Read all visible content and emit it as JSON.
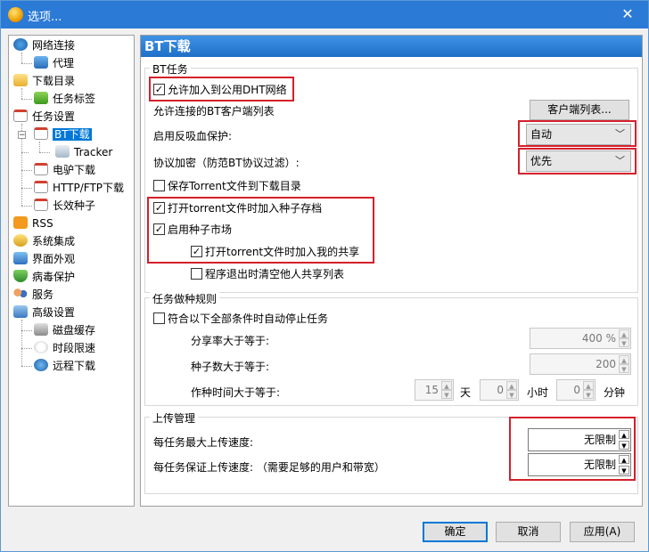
{
  "window": {
    "title": "选项..."
  },
  "tree": {
    "items": [
      {
        "label": "网络连接"
      },
      {
        "label": "代理"
      },
      {
        "label": "下载目录"
      },
      {
        "label": "任务标签"
      },
      {
        "label": "任务设置"
      },
      {
        "label": "BT下载"
      },
      {
        "label": "Tracker"
      },
      {
        "label": "电驴下载"
      },
      {
        "label": "HTTP/FTP下载"
      },
      {
        "label": "长效种子"
      },
      {
        "label": "RSS"
      },
      {
        "label": "系统集成"
      },
      {
        "label": "界面外观"
      },
      {
        "label": "病毒保护"
      },
      {
        "label": "服务"
      },
      {
        "label": "高级设置"
      },
      {
        "label": "磁盘缓存"
      },
      {
        "label": "时段限速"
      },
      {
        "label": "远程下载"
      }
    ]
  },
  "panel": {
    "title": "BT下载",
    "bt_task": {
      "group_title": "BT任务",
      "allow_dht": {
        "label": "允许加入到公用DHT网络",
        "checked": true
      },
      "allowed_clients_label": "允许连接的BT客户端列表",
      "client_list_button": "客户端列表...",
      "anti_leech_label": "启用反吸血保护:",
      "anti_leech_value": "自动",
      "protocol_encryption_label": "协议加密（防范BT协议过滤）:",
      "protocol_encryption_value": "优先",
      "save_torrent": {
        "label": "保存Torrent文件到下载目录",
        "checked": false
      },
      "add_to_seed_archive": {
        "label": "打开torrent文件时加入种子存档",
        "checked": true
      },
      "enable_seed_market": {
        "label": "启用种子市场",
        "checked": true
      },
      "add_to_my_share": {
        "label": "打开torrent文件时加入我的共享",
        "checked": true
      },
      "clear_others_share": {
        "label": "程序退出时清空他人共享列表",
        "checked": false
      }
    },
    "seeding_rules": {
      "group_title": "任务做种规则",
      "auto_stop": {
        "label": "符合以下全部条件时自动停止任务",
        "checked": false
      },
      "share_ratio_label": "分享率大于等于:",
      "share_ratio_value": "400 %",
      "seeds_label": "种子数大于等于:",
      "seeds_value": "200",
      "seed_time_label": "作种时间大于等于:",
      "days_value": "15",
      "days_unit": "天",
      "hours_value": "0",
      "hours_unit": "小时",
      "minutes_value": "0",
      "minutes_unit": "分钟"
    },
    "upload": {
      "group_title": "上传管理",
      "max_upload_label": "每任务最大上传速度:",
      "max_upload_value": "无限制",
      "guaranteed_upload_label": "每任务保证上传速度: （需要足够的用户和带宽）",
      "guaranteed_upload_value": "无限制"
    }
  },
  "footer": {
    "ok": "确定",
    "cancel": "取消",
    "apply": "应用(A)"
  },
  "colors": {
    "accent": "#0078d7",
    "highlight": "#d4202c",
    "titlebar": "#2b7ad6"
  }
}
